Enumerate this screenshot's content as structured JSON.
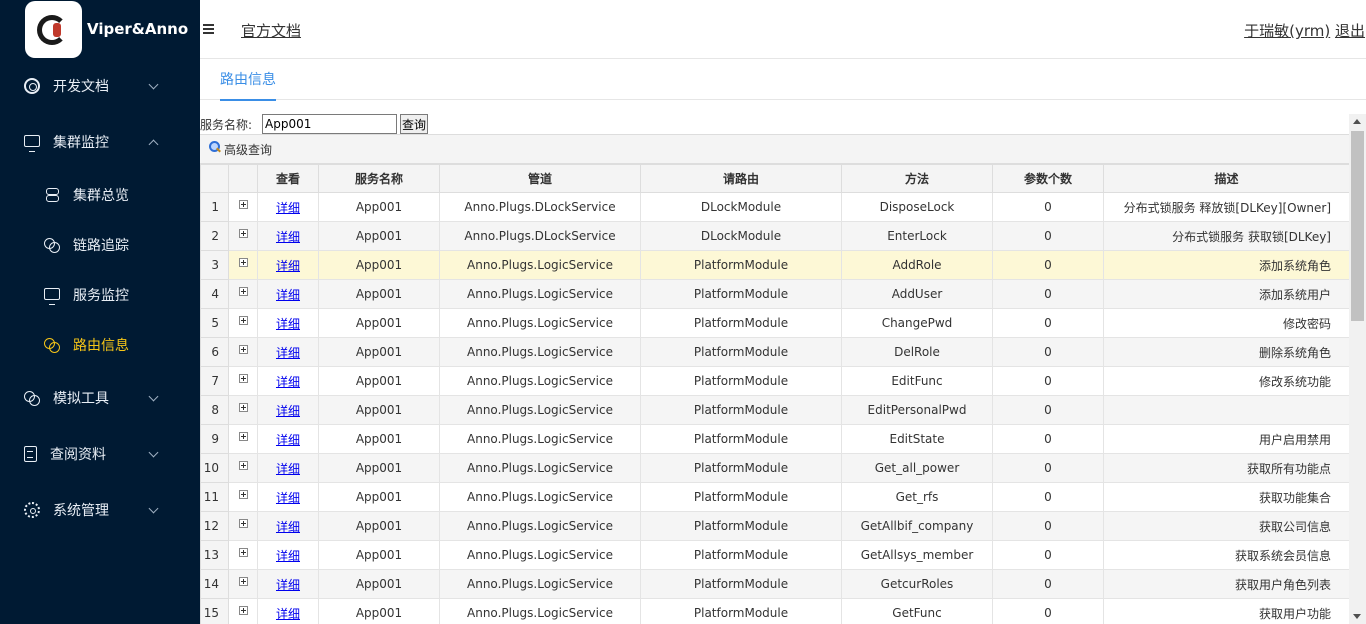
{
  "brand": {
    "title": "Viper&Anno"
  },
  "sidebar": {
    "items": [
      {
        "label": "开发文档",
        "icon": "target-icon",
        "expanded": false
      },
      {
        "label": "集群监控",
        "icon": "monitor-icon",
        "expanded": true,
        "children": [
          {
            "label": "集群总览",
            "icon": "stack-icon",
            "active": false
          },
          {
            "label": "链路追踪",
            "icon": "links-icon",
            "active": false
          },
          {
            "label": "服务监控",
            "icon": "monitor-icon",
            "active": false
          },
          {
            "label": "路由信息",
            "icon": "links-icon",
            "active": true
          }
        ]
      },
      {
        "label": "模拟工具",
        "icon": "links-icon",
        "expanded": false
      },
      {
        "label": "查阅资料",
        "icon": "document-icon",
        "expanded": false
      },
      {
        "label": "系统管理",
        "icon": "gear-icon",
        "expanded": false
      }
    ]
  },
  "header": {
    "doc_link": "官方文档",
    "user": "于瑞敏(yrm)",
    "logout": "退出"
  },
  "tabs": [
    {
      "label": "路由信息",
      "active": true
    }
  ],
  "search": {
    "label": "服务名称:",
    "value": "App001",
    "button": "查询",
    "advanced": "高级查询"
  },
  "table": {
    "columns": [
      "查看",
      "服务名称",
      "管道",
      "请路由",
      "方法",
      "参数个数",
      "描述"
    ],
    "detail_link": "详细",
    "rows": [
      {
        "no": "1",
        "service": "App001",
        "pipe": "Anno.Plugs.DLockService",
        "route": "DLockModule",
        "method": "DisposeLock",
        "params": "0",
        "desc": "分布式锁服务 释放锁[DLKey][Owner]"
      },
      {
        "no": "2",
        "service": "App001",
        "pipe": "Anno.Plugs.DLockService",
        "route": "DLockModule",
        "method": "EnterLock",
        "params": "0",
        "desc": "分布式锁服务 获取锁[DLKey]"
      },
      {
        "no": "3",
        "service": "App001",
        "pipe": "Anno.Plugs.LogicService",
        "route": "PlatformModule",
        "method": "AddRole",
        "params": "0",
        "desc": "添加系统角色"
      },
      {
        "no": "4",
        "service": "App001",
        "pipe": "Anno.Plugs.LogicService",
        "route": "PlatformModule",
        "method": "AddUser",
        "params": "0",
        "desc": "添加系统用户"
      },
      {
        "no": "5",
        "service": "App001",
        "pipe": "Anno.Plugs.LogicService",
        "route": "PlatformModule",
        "method": "ChangePwd",
        "params": "0",
        "desc": "修改密码"
      },
      {
        "no": "6",
        "service": "App001",
        "pipe": "Anno.Plugs.LogicService",
        "route": "PlatformModule",
        "method": "DelRole",
        "params": "0",
        "desc": "删除系统角色"
      },
      {
        "no": "7",
        "service": "App001",
        "pipe": "Anno.Plugs.LogicService",
        "route": "PlatformModule",
        "method": "EditFunc",
        "params": "0",
        "desc": "修改系统功能"
      },
      {
        "no": "8",
        "service": "App001",
        "pipe": "Anno.Plugs.LogicService",
        "route": "PlatformModule",
        "method": "EditPersonalPwd",
        "params": "0",
        "desc": ""
      },
      {
        "no": "9",
        "service": "App001",
        "pipe": "Anno.Plugs.LogicService",
        "route": "PlatformModule",
        "method": "EditState",
        "params": "0",
        "desc": "用户启用禁用"
      },
      {
        "no": "10",
        "service": "App001",
        "pipe": "Anno.Plugs.LogicService",
        "route": "PlatformModule",
        "method": "Get_all_power",
        "params": "0",
        "desc": "获取所有功能点"
      },
      {
        "no": "11",
        "service": "App001",
        "pipe": "Anno.Plugs.LogicService",
        "route": "PlatformModule",
        "method": "Get_rfs",
        "params": "0",
        "desc": "获取功能集合"
      },
      {
        "no": "12",
        "service": "App001",
        "pipe": "Anno.Plugs.LogicService",
        "route": "PlatformModule",
        "method": "GetAllbif_company",
        "params": "0",
        "desc": "获取公司信息"
      },
      {
        "no": "13",
        "service": "App001",
        "pipe": "Anno.Plugs.LogicService",
        "route": "PlatformModule",
        "method": "GetAllsys_member",
        "params": "0",
        "desc": "获取系统会员信息"
      },
      {
        "no": "14",
        "service": "App001",
        "pipe": "Anno.Plugs.LogicService",
        "route": "PlatformModule",
        "method": "GetcurRoles",
        "params": "0",
        "desc": "获取用户角色列表"
      },
      {
        "no": "15",
        "service": "App001",
        "pipe": "Anno.Plugs.LogicService",
        "route": "PlatformModule",
        "method": "GetFunc",
        "params": "0",
        "desc": "获取用户功能"
      }
    ],
    "highlighted_row": "3"
  },
  "colors": {
    "sidebar_bg": "#001a33",
    "active_menu": "#f5c518",
    "tab_accent": "#3a8ee6",
    "row_highlight": "#fdf8d6",
    "link": "#0000ee"
  }
}
